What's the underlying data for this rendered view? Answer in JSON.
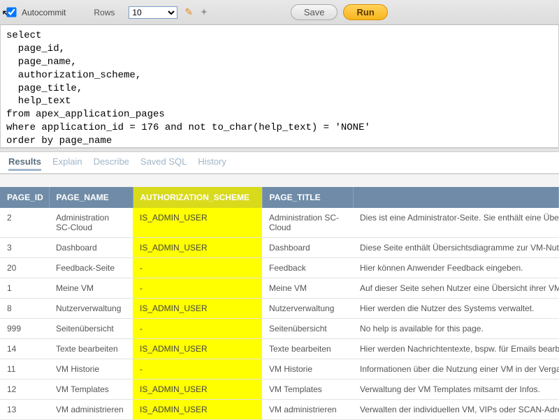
{
  "toolbar": {
    "autocommit_label": "Autocommit",
    "autocommit_checked": true,
    "rows_label": "Rows",
    "rows_value": "10",
    "save_label": "Save",
    "run_label": "Run"
  },
  "sql": "select\n  page_id,\n  page_name,\n  authorization_scheme,\n  page_title,\n  help_text\nfrom apex_application_pages\nwhere application_id = 176 and not to_char(help_text) = 'NONE'\norder by page_name",
  "tabs": {
    "results": "Results",
    "explain": "Explain",
    "describe": "Describe",
    "saved_sql": "Saved SQL",
    "history": "History"
  },
  "columns": {
    "page_id": "PAGE_ID",
    "page_name": "PAGE_NAME",
    "authorization_scheme": "AUTHORIZATION_SCHEME",
    "page_title": "PAGE_TITLE",
    "help_text": ""
  },
  "rows": [
    {
      "page_id": "2",
      "page_name": "Administration SC-Cloud",
      "auth": "IS_ADMIN_USER",
      "page_title": "Administration SC-Cloud",
      "help": "Dies ist eine Administrator-Seite. Sie enthält eine Übersicht über die Anforderungen aller Nutzer. Alle VMs können bearbeitet werden (z.B. Änderung des Ablaufdatums). Daneben ist eine..."
    },
    {
      "page_id": "3",
      "page_name": "Dashboard",
      "auth": "IS_ADMIN_USER",
      "page_title": "Dashboard",
      "help": "Diese Seite enthält Übersichtsdiagramme zur VM-Nutzung, Template sowie eine Tabelle mit Details."
    },
    {
      "page_id": "20",
      "page_name": "Feedback-Seite",
      "auth": "-",
      "page_title": "Feedback",
      "help": "Hier können Anwender Feedback eingeben."
    },
    {
      "page_id": "1",
      "page_name": "Meine VM",
      "auth": "-",
      "page_title": "Meine VM",
      "help": "Auf dieser Seite sehen Nutzer eine Übersicht ihrer VMs. Bestehende VMs können hochgefahren, heruntergefahren..."
    },
    {
      "page_id": "8",
      "page_name": "Nutzerverwaltung",
      "auth": "IS_ADMIN_USER",
      "page_title": "Nutzerverwaltung",
      "help": "Hier werden die Nutzer des Systems verwaltet."
    },
    {
      "page_id": "999",
      "page_name": "Seitenübersicht",
      "auth": "-",
      "page_title": "Seitenübersicht",
      "help": "No help is available for this page."
    },
    {
      "page_id": "14",
      "page_name": "Texte bearbeiten",
      "auth": "IS_ADMIN_USER",
      "page_title": "Texte bearbeiten",
      "help": "Hier werden Nachrichtentexte, bspw. für Emails bearbeitet."
    },
    {
      "page_id": "11",
      "page_name": "VM Historie",
      "auth": "-",
      "page_title": "VM Historie",
      "help": "Informationen über die Nutzung einer VM in der Vergangenheit."
    },
    {
      "page_id": "12",
      "page_name": "VM Templates",
      "auth": "IS_ADMIN_USER",
      "page_title": "VM Templates",
      "help": "Verwaltung der VM Templates mitsamt der Infos."
    },
    {
      "page_id": "13",
      "page_name": "VM administrieren",
      "auth": "IS_ADMIN_USER",
      "page_title": "VM administrieren",
      "help": "Verwalten der individuellen VM, VIPs oder SCAN-Adressen, Zuordnung zum konkreten VM Pool, die IP-Adressen..."
    }
  ]
}
